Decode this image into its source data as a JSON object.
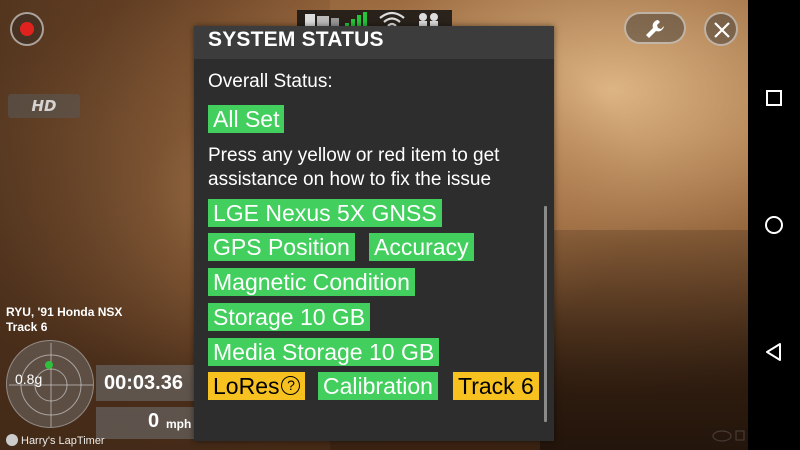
{
  "app": {
    "hd_label": "HD",
    "car_line": "RYU, '91 Honda NSX",
    "track_line": "Track 6",
    "gforce_value": "0.8g",
    "timer": "00:03.36",
    "speed_value": "0",
    "speed_unit": "mph",
    "brand": "Harry's LapTimer"
  },
  "dialog": {
    "title": "SYSTEM STATUS",
    "overall_label": "Overall Status:",
    "overall_value": "All Set",
    "help_line_1": "Press any yellow or red item to get",
    "help_line_2": "assistance on how to fix the issue",
    "items": [
      {
        "label": "LGE Nexus 5X GNSS",
        "status": "ok"
      },
      {
        "label": "GPS Position",
        "status": "ok"
      },
      {
        "label": "Accuracy",
        "status": "ok"
      },
      {
        "label": "Magnetic Condition",
        "status": "ok"
      },
      {
        "label": "Storage 10 GB",
        "status": "ok"
      },
      {
        "label": "Media Storage 10 GB",
        "status": "ok"
      },
      {
        "label": "LoRes",
        "status": "warning",
        "help_icon": "?"
      },
      {
        "label": "Calibration",
        "status": "ok"
      },
      {
        "label": "Track 6",
        "status": "warning"
      }
    ]
  },
  "colors": {
    "ok": "#43cf5e",
    "warning": "#f7c21f",
    "dialog_bg": "#2d2d2d",
    "dialog_header_bg": "#3c3c3c",
    "record": "#e0221e"
  },
  "icons": {
    "record": "record-icon",
    "signal": "cell-signal-icon",
    "wifi": "wifi-icon",
    "dual": "dual-circle-icon",
    "settings": "wrench-icon",
    "close": "close-icon",
    "help": "help-circle-icon",
    "nav_recents": "square-recents-icon",
    "nav_home": "circle-home-icon",
    "nav_back": "triangle-back-icon"
  }
}
